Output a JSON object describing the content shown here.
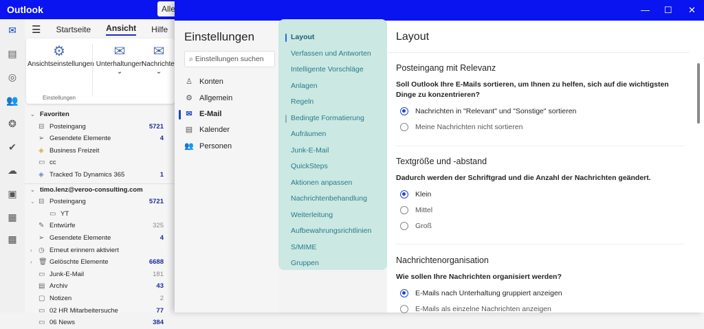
{
  "app": {
    "title": "Outlook",
    "search_stub": "Alle"
  },
  "ribbon": {
    "tabs": [
      "Startseite",
      "Ansicht",
      "Hilfe"
    ],
    "active_tab": "Ansicht",
    "buttons": [
      "Ansichtseinstellungen",
      "Unterhaltungen",
      "Nachrichten"
    ],
    "group": "Einstellungen"
  },
  "favorites": {
    "header": "Favoriten",
    "items": [
      {
        "label": "Posteingang",
        "count": "5721"
      },
      {
        "label": "Gesendete Elemente",
        "count": "4"
      },
      {
        "label": "Business Freizeit",
        "count": ""
      },
      {
        "label": "cc",
        "count": ""
      },
      {
        "label": "Tracked To Dynamics 365",
        "count": "1"
      }
    ]
  },
  "account": {
    "header": "timo.lenz@veroo-consulting.com",
    "items": [
      {
        "label": "Posteingang",
        "count": "5721"
      },
      {
        "label": "YT",
        "count": ""
      },
      {
        "label": "Entwürfe",
        "count": "325"
      },
      {
        "label": "Gesendete Elemente",
        "count": "4"
      },
      {
        "label": "Erneut erinnern aktiviert",
        "count": ""
      },
      {
        "label": "Gelöschte Elemente",
        "count": "6688"
      },
      {
        "label": "Junk-E-Mail",
        "count": "181"
      },
      {
        "label": "Archiv",
        "count": "43"
      },
      {
        "label": "Notizen",
        "count": "2"
      },
      {
        "label": "02 HR Mitarbeitersuche",
        "count": "77"
      },
      {
        "label": "06 News",
        "count": "384"
      }
    ]
  },
  "settings": {
    "title": "Einstellungen",
    "search_placeholder": "Einstellungen suchen",
    "nav": [
      "Konten",
      "Allgemein",
      "E-Mail",
      "Kalender",
      "Personen"
    ],
    "active_nav": "E-Mail",
    "sub": [
      "Layout",
      "Verfassen und Antworten",
      "Intelligente Vorschläge",
      "Anlagen",
      "Regeln",
      "Bedingte Formatierung",
      "Aufräumen",
      "Junk-E-Mail",
      "QuickSteps",
      "Aktionen anpassen",
      "Nachrichtenbehandlung",
      "Weiterleitung",
      "Aufbewahrungsrichtlinien",
      "S/MIME",
      "Gruppen"
    ],
    "active_sub": "Layout"
  },
  "content": {
    "title": "Layout",
    "sections": [
      {
        "heading": "Posteingang mit Relevanz",
        "question": "Soll Outlook Ihre E-Mails sortieren, um Ihnen zu helfen, sich auf die wichtigsten Dinge zu konzentrieren?",
        "options": [
          "Nachrichten in \"Relevant\" und \"Sonstige\" sortieren",
          "Meine Nachrichten nicht sortieren"
        ],
        "selected": 0
      },
      {
        "heading": "Textgröße und -abstand",
        "question": "Dadurch werden der Schriftgrad und die Anzahl der Nachrichten geändert.",
        "options": [
          "Klein",
          "Mittel",
          "Groß"
        ],
        "selected": 0
      },
      {
        "heading": "Nachrichtenorganisation",
        "question": "Wie sollen Ihre Nachrichten organisiert werden?",
        "options": [
          "E-Mails nach Unterhaltung gruppiert anzeigen",
          "E-Mails als einzelne Nachrichten anzeigen"
        ],
        "selected": 0
      }
    ]
  }
}
